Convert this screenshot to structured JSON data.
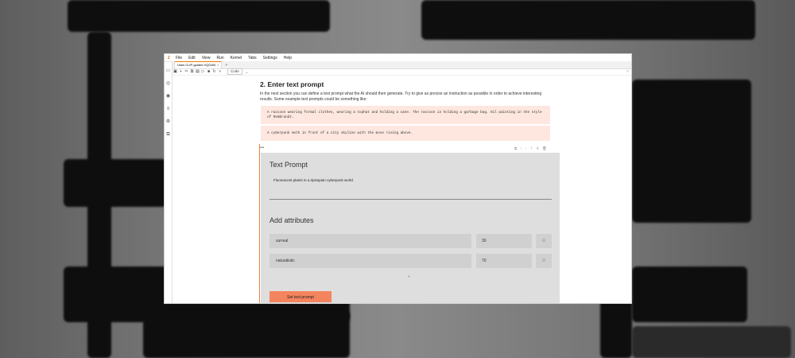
{
  "menu": {
    "logo": "J",
    "items": [
      "File",
      "Edit",
      "View",
      "Run",
      "Kernel",
      "Tabs",
      "Settings",
      "Help"
    ]
  },
  "tab": {
    "title": "Uses CLIP-guided VQGAN",
    "close": "×",
    "add": "+"
  },
  "toolbar": {
    "icons": [
      "save-icon",
      "add-cell-icon",
      "cut-icon",
      "copy-icon",
      "paste-icon",
      "run-icon",
      "stop-icon",
      "restart-icon",
      "fast-forward-icon"
    ],
    "cell_type": "Code",
    "caret": "⌄"
  },
  "notebook": {
    "heading": "2. Enter text prompt",
    "paragraph": "In the next section you can define a text prompt what the AI should then generate. Try to give as precise an instruction as possible in order to achieve interesting results. Some example text prompts could be something like:",
    "examples": [
      "A raccoon wearing formal clothes, wearing a tophat and holding a cane. The raccoon is holding a garbage bag. Oil painting in the style of Rembrandt.",
      "A cyberpunk moth in front of a city skyline with the moon rising above."
    ],
    "ellipsis": "•••"
  },
  "widget": {
    "text_prompt_title": "Text Prompt",
    "prompt_value": "Fluorescent plants in a dystopian cyberpunk world.",
    "attributes_title": "Add attributes",
    "attributes": [
      {
        "name": "surreal",
        "value": "30"
      },
      {
        "name": "naturalistic",
        "value": "70"
      }
    ],
    "add_symbol": "+",
    "remove_symbol": "⊖",
    "set_button": "Set text prompt"
  },
  "colors": {
    "accent": "#f4845e",
    "code_bg": "#fde7df",
    "widget_bg": "#dedede"
  }
}
